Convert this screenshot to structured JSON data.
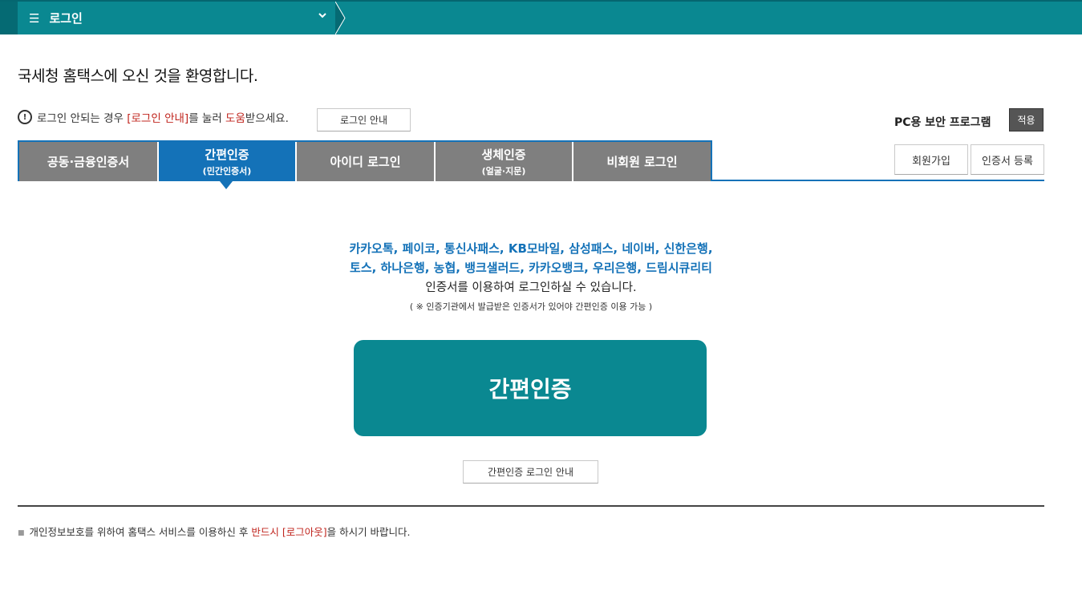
{
  "topbar": {
    "menu_icon": "☰",
    "title": "로그인",
    "chevron": "⌄"
  },
  "welcome": "국세청 홈택스에 오신 것을 환영합니다.",
  "notice": {
    "icon": "!",
    "text_before": "로그인 안되는 경우",
    "link_text": "[로그인 안내]",
    "text_middle": "를 눌러",
    "help_text": "도움",
    "text_after": "받으세요.",
    "guide_button": "로그인 안내"
  },
  "security": {
    "label": "PC용 보안 프로그램",
    "apply_button": "적용"
  },
  "account_buttons": {
    "join": "회원가입",
    "cert_register": "인증서 등록"
  },
  "tabs": [
    {
      "label": "공동·금융인증서",
      "sub": ""
    },
    {
      "label": "간편인증",
      "sub": "(민간인증서)"
    },
    {
      "label": "아이디 로그인",
      "sub": ""
    },
    {
      "label": "생체인증",
      "sub": "(얼굴·지문)"
    },
    {
      "label": "비회원 로그인",
      "sub": ""
    }
  ],
  "content": {
    "providers_line1": "카카오톡, 페이코, 통신사패스, KB모바일, 삼성패스, 네이버, 신한은행,",
    "providers_line2": "토스, 하나은행, 농협, 뱅크샐러드, 카카오뱅크, 우리은행, 드림시큐리티",
    "description": "인증서를 이용하여 로그인하실 수 있습니다.",
    "note": "( ※ 인증기관에서 발급받은 인증서가 있어야 간편인증 이용 가능 )",
    "main_button": "간편인증",
    "guide_button": "간편인증 로그인 안내"
  },
  "footer": {
    "text_before": "개인정보보호를 위하여 홈택스 서비스를 이용하신 후",
    "highlight": "반드시 [로그아웃]",
    "text_after": "을 하시기 바랍니다."
  },
  "colors": {
    "teal": "#0a8891",
    "blue": "#1472b8",
    "tab_gray": "#7f7f7f",
    "red": "#c0241d"
  }
}
